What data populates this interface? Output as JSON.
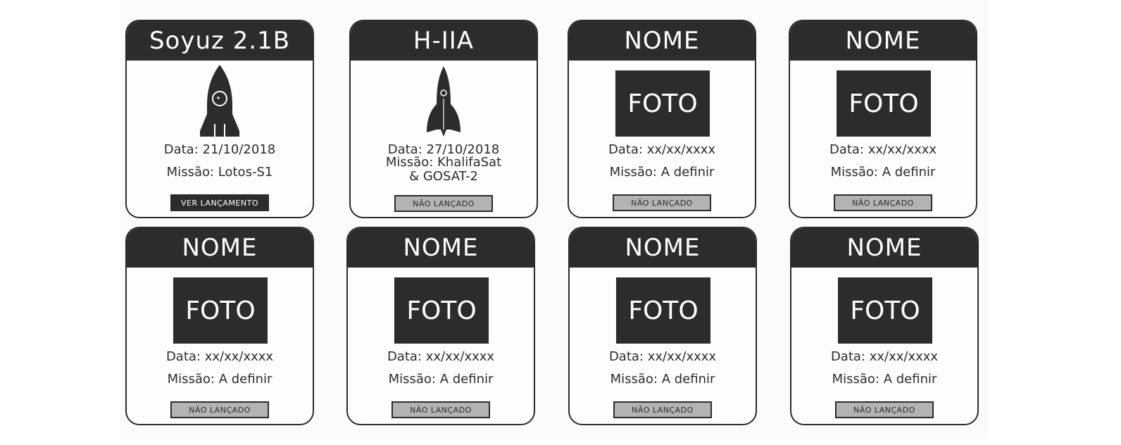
{
  "colors": {
    "dark": "#2d2c2d",
    "button_gray": "#b3b3b3",
    "card_bg": "#fdfdfd"
  },
  "cards": [
    {
      "name": "Soyuz 2.1B",
      "media": "rocket-icon",
      "date": "Data: 21/10/2018",
      "mission": "Missão: Lotos-S1",
      "button": "VER LANÇAMENTO",
      "status": "active"
    },
    {
      "name": "H-IIA",
      "media": "rocket-slim-icon",
      "date": "Data: 27/10/2018",
      "mission": "Missão: KhalifaSat\n& GOSAT-2",
      "button": "NÃO LANÇADO",
      "status": "inactive"
    },
    {
      "name": "NOME",
      "photo": "FOTO",
      "date": "Data: xx/xx/xxxx",
      "mission": "Missão: A definir",
      "button": "NÃO LANÇADO",
      "status": "inactive"
    },
    {
      "name": "NOME",
      "photo": "FOTO",
      "date": "Data: xx/xx/xxxx",
      "mission": "Missão: A definir",
      "button": "NÃO LANÇADO",
      "status": "inactive"
    },
    {
      "name": "NOME",
      "photo": "FOTO",
      "date": "Data: xx/xx/xxxx",
      "mission": "Missão: A definir",
      "button": "NÃO LANÇADO",
      "status": "inactive"
    },
    {
      "name": "NOME",
      "photo": "FOTO",
      "date": "Data: xx/xx/xxxx",
      "mission": "Missão: A definir",
      "button": "NÃO LANÇADO",
      "status": "inactive"
    },
    {
      "name": "NOME",
      "photo": "FOTO",
      "date": "Data: xx/xx/xxxx",
      "mission": "Missão: A definir",
      "button": "NÃO LANÇADO",
      "status": "inactive"
    },
    {
      "name": "NOME",
      "photo": "FOTO",
      "date": "Data: xx/xx/xxxx",
      "mission": "Missão: A definir",
      "button": "NÃO LANÇADO",
      "status": "inactive"
    }
  ]
}
